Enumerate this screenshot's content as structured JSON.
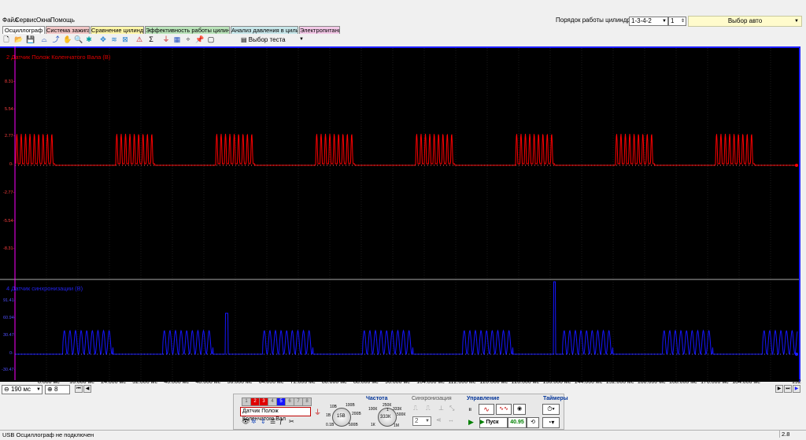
{
  "menu": {
    "items": [
      "Файл",
      "Сервис",
      "Окна",
      "Помощь"
    ],
    "cyl_order_label": "Порядок работы цилиндров",
    "cyl_order_value": "1-3-4-2",
    "cyl_number": "1",
    "auto_select": "Выбор авто"
  },
  "tabs": [
    {
      "label": "Осциллограф",
      "color": "#ffffff"
    },
    {
      "label": "Система зажигания",
      "color": "#f2c7c7"
    },
    {
      "label": "Сравнение цилиндров",
      "color": "#fff6a8"
    },
    {
      "label": "Эффективность работы цилиндров",
      "color": "#b9e3b9"
    },
    {
      "label": "Анализ давления в цилиндре",
      "color": "#c7e6e9"
    },
    {
      "label": "Электропитание",
      "color": "#f3c9e7"
    }
  ],
  "toolbar": {
    "test_select": "Выбор теста"
  },
  "panels": {
    "top": {
      "title": "2 Датчик Полож Коленчатого Вала (В)",
      "color": "#ff0000",
      "y_ticks": [
        "8.31-",
        "5.54-",
        "2.77-",
        "0-",
        "-2.77-",
        "-5.54-",
        "-8.31-"
      ]
    },
    "bottom": {
      "title": "4 Датчик синхронизации (В)",
      "color": "#1010ff",
      "y_ticks": [
        "91.41-",
        "60.94-",
        "30.47-",
        "0-",
        "-30.47-"
      ]
    }
  },
  "x_axis": {
    "ticks": [
      "8.000 мс",
      "16.000 мс",
      "24.000 мс",
      "32.000 мс",
      "40.000 мс",
      "48.000 мс",
      "56.000 мс",
      "64.000 мс",
      "72.000 мс",
      "80.000 мс",
      "88.000 мс",
      "96.000 мс",
      "104.000 мс",
      "112.000 мс",
      "120.000 мс",
      "128.000 мс",
      "136.000 мс",
      "144.000 мс",
      "152.000 мс",
      "160.000 мс",
      "168.000 мс",
      "176.000 мс",
      "184.000 мс",
      "192"
    ]
  },
  "scroll": {
    "timebase": "190 мс",
    "page": "8"
  },
  "control": {
    "channels": [
      "1",
      "2",
      "3",
      "4",
      "5",
      "6",
      "7",
      "8"
    ],
    "sensor_select": "Датчик Полож Коленчатого Вал",
    "volt_center": "15В",
    "volt_labels": [
      "10В",
      "100В",
      "200В",
      "1В",
      "500В",
      "0.1В"
    ],
    "freq_title": "Частота",
    "freq_center": "333К",
    "freq_labels": [
      "250К",
      "100К",
      "1",
      "333К",
      "500К",
      "1К",
      "1М"
    ],
    "sync_title": "Синхронизация",
    "sync_value": "2",
    "manage_title": "Управление",
    "start_label": "Пуск",
    "counter": "40.95",
    "timers_title": "Таймеры"
  },
  "status": {
    "text": "USB Осциллограф не подключен",
    "version": "2.8"
  }
}
